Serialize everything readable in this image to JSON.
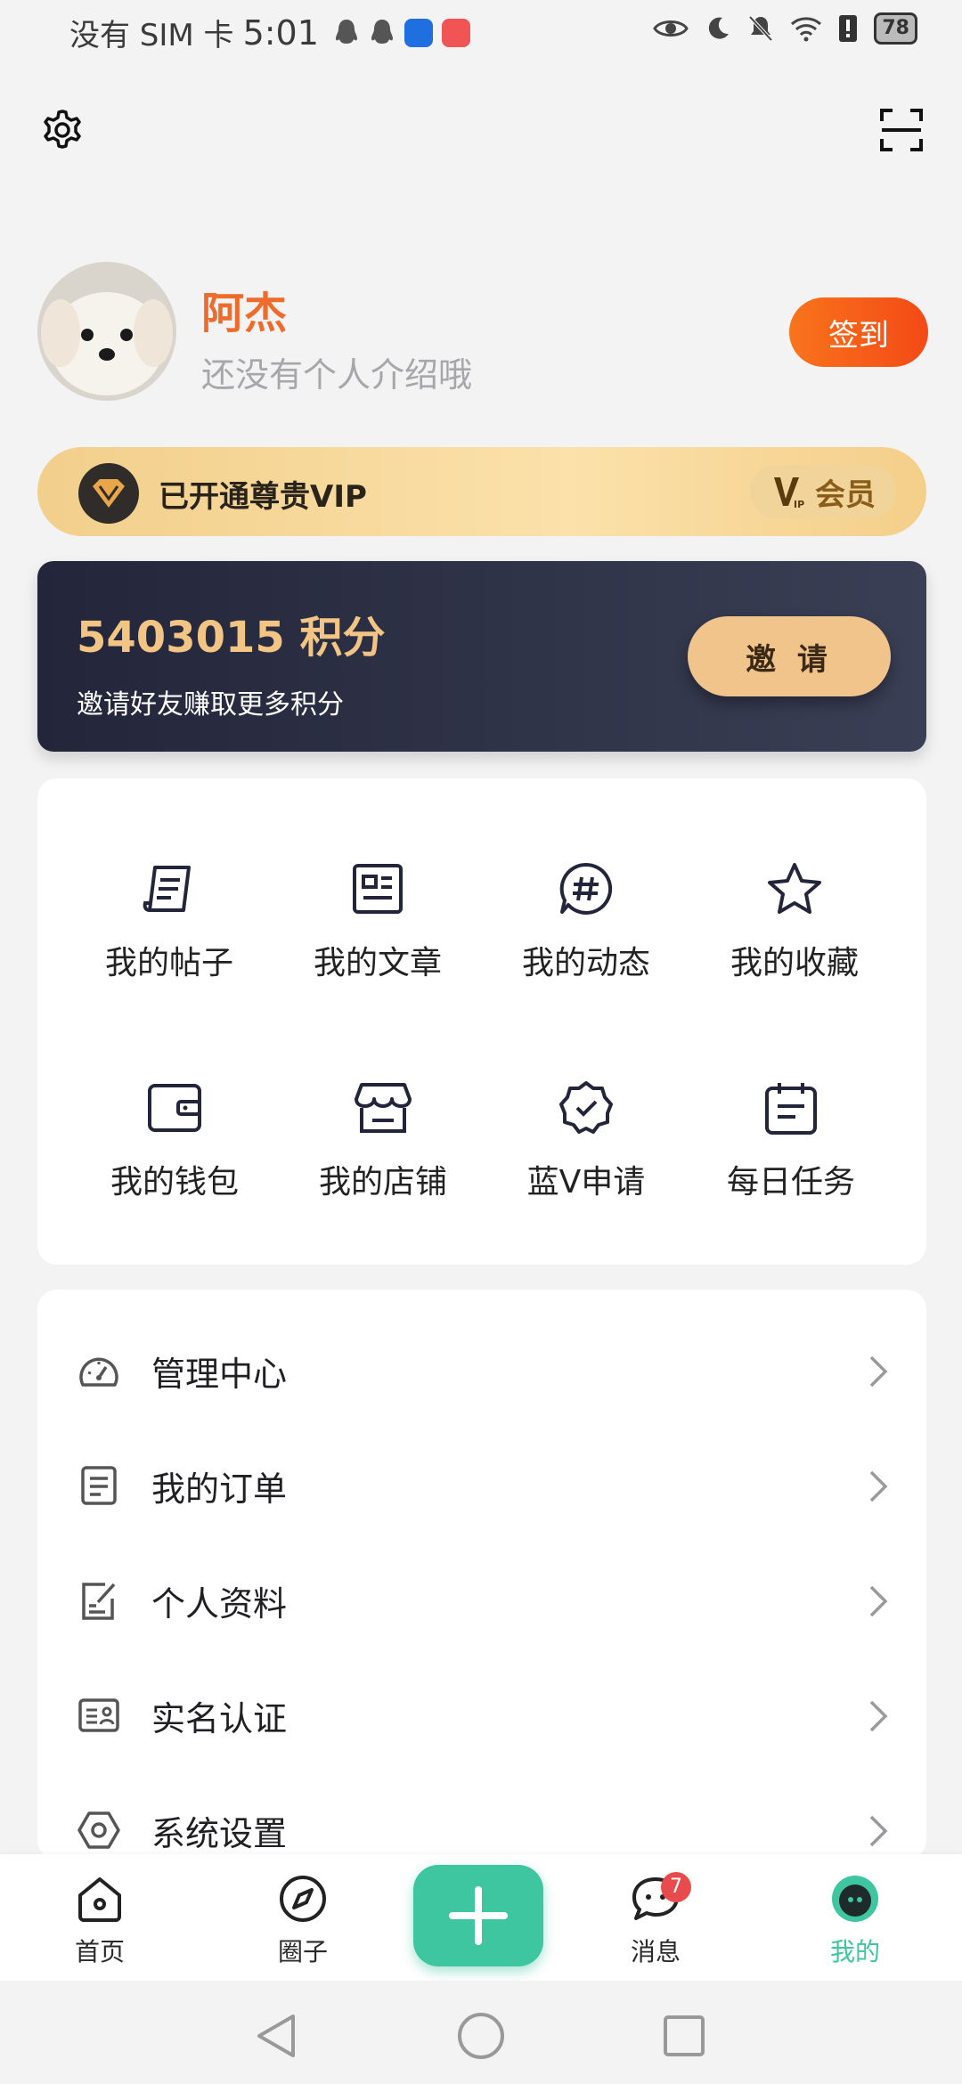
{
  "status_bar": {
    "carrier": "没有 SIM 卡",
    "time": "5:01",
    "battery": "78"
  },
  "profile": {
    "name": "阿杰",
    "bio": "还没有个人介绍哦",
    "signin_label": "签到"
  },
  "vip": {
    "title": "已开通尊贵VIP",
    "member_label": "会员"
  },
  "points": {
    "value": "5403015 积分",
    "subtitle": "邀请好友赚取更多积分",
    "invite_label": "邀 请"
  },
  "grid": {
    "items": [
      {
        "label": "我的帖子",
        "icon": "post-icon"
      },
      {
        "label": "我的文章",
        "icon": "article-icon"
      },
      {
        "label": "我的动态",
        "icon": "hashtag-icon"
      },
      {
        "label": "我的收藏",
        "icon": "star-icon"
      },
      {
        "label": "我的钱包",
        "icon": "wallet-icon"
      },
      {
        "label": "我的店铺",
        "icon": "store-icon"
      },
      {
        "label": "蓝V申请",
        "icon": "verified-badge-icon"
      },
      {
        "label": "每日任务",
        "icon": "calendar-task-icon"
      }
    ]
  },
  "menu": {
    "items": [
      {
        "label": "管理中心",
        "icon": "dashboard-icon"
      },
      {
        "label": "我的订单",
        "icon": "order-list-icon"
      },
      {
        "label": "个人资料",
        "icon": "edit-profile-icon"
      },
      {
        "label": "实名认证",
        "icon": "id-card-icon"
      },
      {
        "label": "系统设置",
        "icon": "hexagon-settings-icon"
      }
    ]
  },
  "bottom_nav": {
    "home": "首页",
    "circle": "圈子",
    "messages": "消息",
    "messages_badge": "7",
    "mine": "我的",
    "accent": "#3ec6a0"
  },
  "colors": {
    "name_orange": "#ef6b2c",
    "vip_gold": "#f3c584",
    "signin_gradient": [
      "#f9731c",
      "#f34a16"
    ]
  }
}
